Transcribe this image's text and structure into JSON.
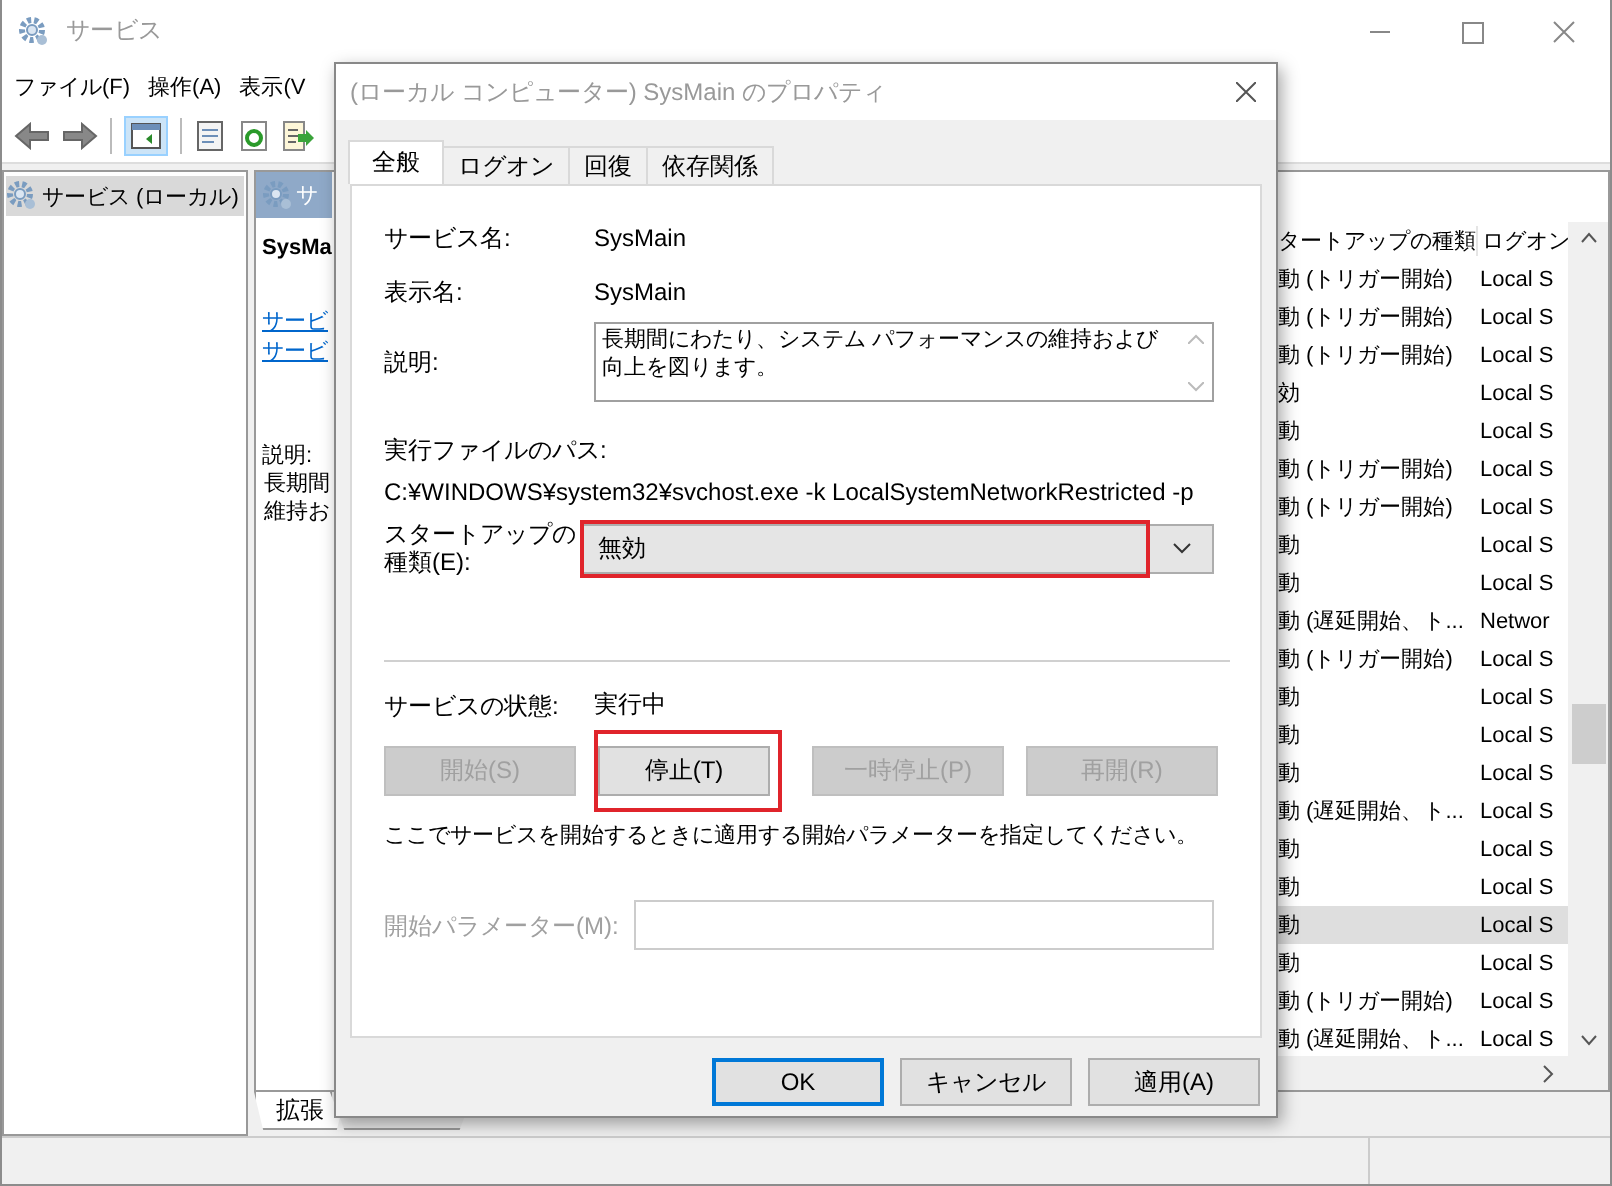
{
  "window": {
    "title": "サービス"
  },
  "menu": [
    "ファイル(F)",
    "操作(A)",
    "表示(V"
  ],
  "tree": [
    {
      "label": "サービス (ローカル)",
      "selected": true
    }
  ],
  "detail_pane": {
    "header": "サ",
    "service_name": "SysMa",
    "links": [
      "サービ",
      "サービ"
    ],
    "description_label": "説明:",
    "description_lines": [
      "長期間",
      "維持お"
    ]
  },
  "services_list": {
    "columns": [
      "タートアップの種類",
      "ログオン"
    ],
    "rows": [
      {
        "startup_type": "動 (トリガー開始)",
        "log_on_as": "Local S",
        "selected": false
      },
      {
        "startup_type": "動 (トリガー開始)",
        "log_on_as": "Local S",
        "selected": false
      },
      {
        "startup_type": "動 (トリガー開始)",
        "log_on_as": "Local S",
        "selected": false
      },
      {
        "startup_type": "効",
        "log_on_as": "Local S",
        "selected": false
      },
      {
        "startup_type": "動",
        "log_on_as": "Local S",
        "selected": false
      },
      {
        "startup_type": "動 (トリガー開始)",
        "log_on_as": "Local S",
        "selected": false
      },
      {
        "startup_type": "動 (トリガー開始)",
        "log_on_as": "Local S",
        "selected": false
      },
      {
        "startup_type": "動",
        "log_on_as": "Local S",
        "selected": false
      },
      {
        "startup_type": "動",
        "log_on_as": "Local S",
        "selected": false
      },
      {
        "startup_type": "動 (遅延開始、ト...",
        "log_on_as": "Networ",
        "selected": false
      },
      {
        "startup_type": "動 (トリガー開始)",
        "log_on_as": "Local S",
        "selected": false
      },
      {
        "startup_type": "動",
        "log_on_as": "Local S",
        "selected": false
      },
      {
        "startup_type": "動",
        "log_on_as": "Local S",
        "selected": false
      },
      {
        "startup_type": "動",
        "log_on_as": "Local S",
        "selected": false
      },
      {
        "startup_type": "動 (遅延開始、ト...",
        "log_on_as": "Local S",
        "selected": false
      },
      {
        "startup_type": "動",
        "log_on_as": "Local S",
        "selected": false
      },
      {
        "startup_type": "動",
        "log_on_as": "Local S",
        "selected": false
      },
      {
        "startup_type": "動",
        "log_on_as": "Local S",
        "selected": true
      },
      {
        "startup_type": "動",
        "log_on_as": "Local S",
        "selected": false
      },
      {
        "startup_type": "動 (トリガー開始)",
        "log_on_as": "Local S",
        "selected": false
      },
      {
        "startup_type": "動 (遅延開始、ト...",
        "log_on_as": "Local S",
        "selected": false
      }
    ]
  },
  "bottom_tabs": [
    {
      "label": "拡張",
      "selected": true
    }
  ],
  "dialog": {
    "title": "(ローカル コンピューター) SysMain のプロパティ",
    "tabs": [
      {
        "label": "全般",
        "selected": true
      },
      {
        "label": "ログオン",
        "selected": false
      },
      {
        "label": "回復",
        "selected": false
      },
      {
        "label": "依存関係",
        "selected": false
      }
    ],
    "service_name": {
      "label": "サービス名:",
      "value": "SysMain"
    },
    "display_name": {
      "label": "表示名:",
      "value": "SysMain"
    },
    "description": {
      "label": "説明:",
      "value": "長期間にわたり、システム パフォーマンスの維持および向上を図ります。"
    },
    "executable_path": {
      "label": "実行ファイルのパス:",
      "value": "C:¥WINDOWS¥system32¥svchost.exe -k LocalSystemNetworkRestricted -p"
    },
    "startup_type": {
      "label": "スタートアップの種類(E):",
      "value": "無効",
      "highlighted": true
    },
    "service_status": {
      "label": "サービスの状態:",
      "value": "実行中"
    },
    "control_buttons": [
      {
        "label": "開始(S)",
        "disabled": true,
        "highlighted": false
      },
      {
        "label": "停止(T)",
        "disabled": false,
        "highlighted": true
      },
      {
        "label": "一時停止(P)",
        "disabled": true,
        "highlighted": false
      },
      {
        "label": "再開(R)",
        "disabled": true,
        "highlighted": false
      }
    ],
    "hint": "ここでサービスを開始するときに適用する開始パラメーターを指定してください。",
    "start_parameters": {
      "label": "開始パラメーター(M):",
      "disabled": true
    },
    "buttons": [
      {
        "label": "OK"
      },
      {
        "label": "キャンセル"
      },
      {
        "label": "適用(A)"
      }
    ]
  }
}
